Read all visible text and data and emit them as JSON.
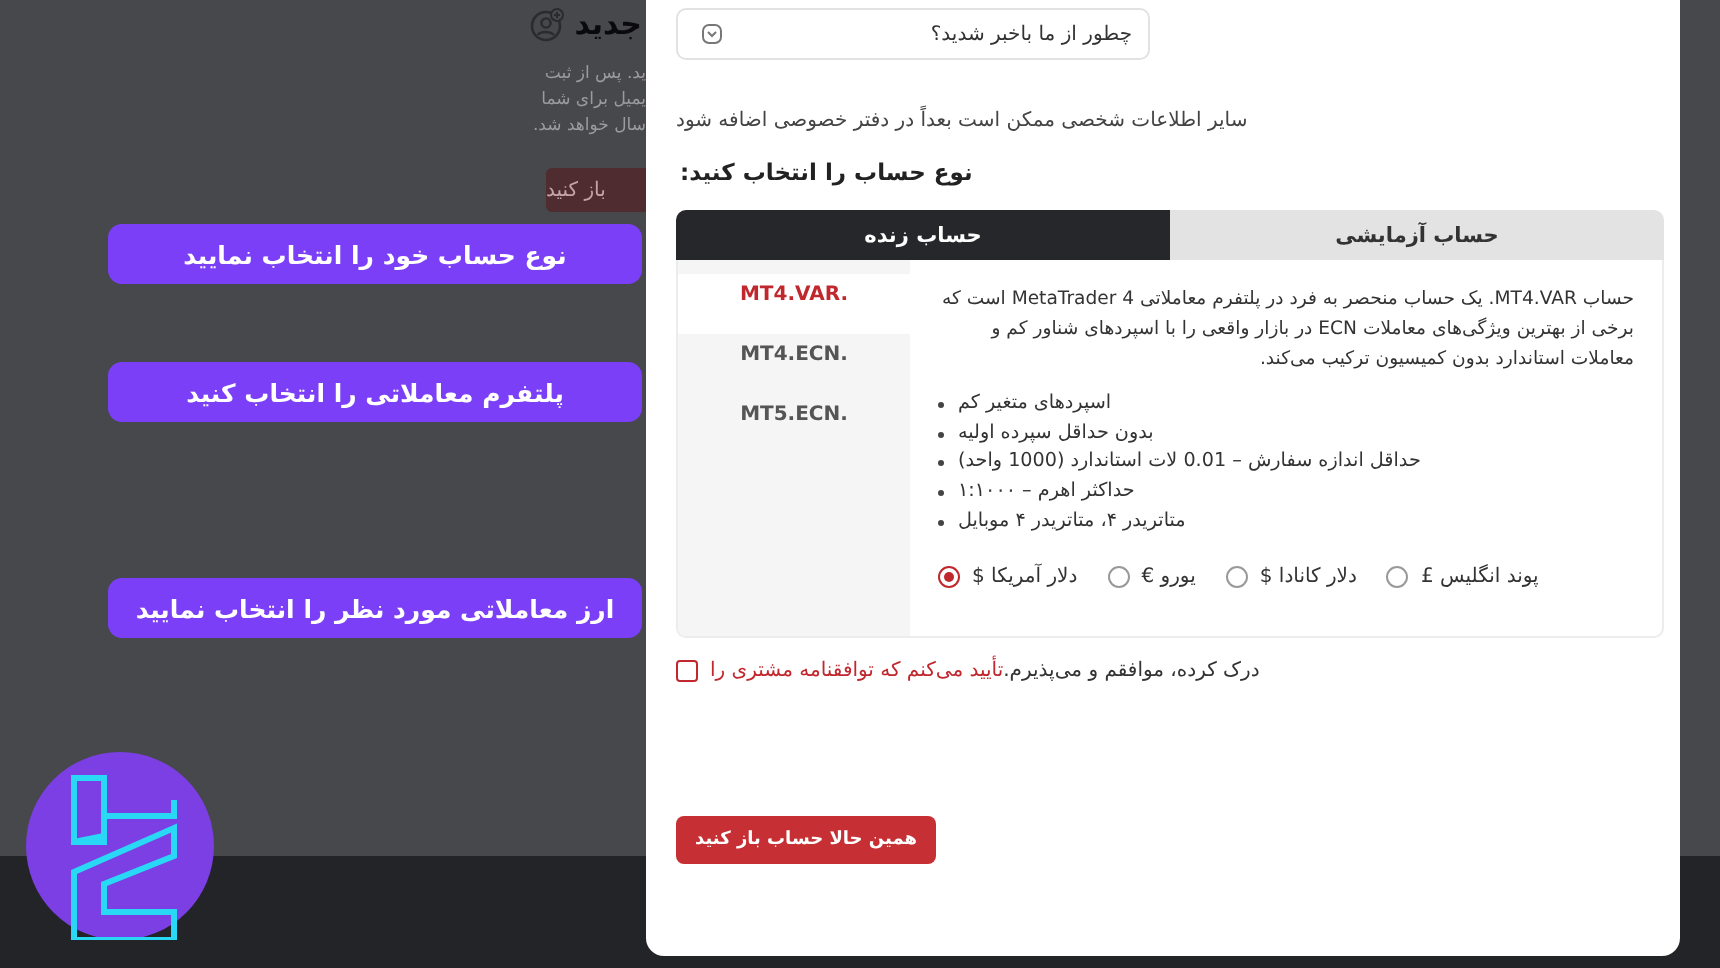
{
  "background": {
    "title": "جدید",
    "lines": [
      "ید. پس از ثبت",
      "یمیل برای شما",
      "سال خواهد شد."
    ],
    "button": "باز کنید"
  },
  "callouts": [
    {
      "text": "نوع حساب خود را انتخاب نمایید"
    },
    {
      "text": "پلتفرم معاملاتی را انتخاب کنید"
    },
    {
      "text": "ارز معاملاتی مورد نظر را انتخاب نمایید"
    }
  ],
  "form": {
    "referral_select": {
      "value": "چطور از ما باخبر شدید؟"
    },
    "note": "سایر اطلاعات شخصی ممکن است بعداً در دفتر خصوصی اضافه شود",
    "account_type_heading": "نوع حساب را انتخاب کنید:",
    "tabs": [
      {
        "label": "حساب آزمایشی",
        "selected": false
      },
      {
        "label": "حساب زنده",
        "selected": true
      }
    ],
    "platforms": [
      {
        "label": "MT4.VAR.",
        "selected": true
      },
      {
        "label": "MT4.ECN.",
        "selected": false
      },
      {
        "label": "MT5.ECN.",
        "selected": false
      }
    ],
    "description": "حساب MT4.VAR. یک حساب منحصر به فرد در پلتفرم معاملاتی MetaTrader 4 است که برخی از بهترین ویژگی‌های معاملات ECN در بازار واقعی را با اسپردهای شناور کم و معاملات استاندارد بدون کمیسیون ترکیب می‌کند.",
    "features": [
      "اسپردهای متغیر کم",
      "بدون حداقل سپرده اولیه",
      "حداقل اندازه سفارش – 0.01 لات استاندارد (1000 واحد)",
      "حداکثر اهرم – ۱:۱۰۰۰",
      "متاتریدر ۴، متاتریدر ۴ موبایل"
    ],
    "currencies": [
      {
        "label": "پوند انگلیس £",
        "selected": false
      },
      {
        "label": "دلار کانادا $",
        "selected": false
      },
      {
        "label": "یورو €",
        "selected": false
      },
      {
        "label": "دلار آمریکا $",
        "selected": true
      }
    ],
    "consent": {
      "checked": false,
      "link": "تأیید می‌کنم که توافقنامه مشتری را",
      "text": "درک کرده، موافقم و می‌پذیرم."
    },
    "submit": "همین حالا حساب باز کنید"
  }
}
